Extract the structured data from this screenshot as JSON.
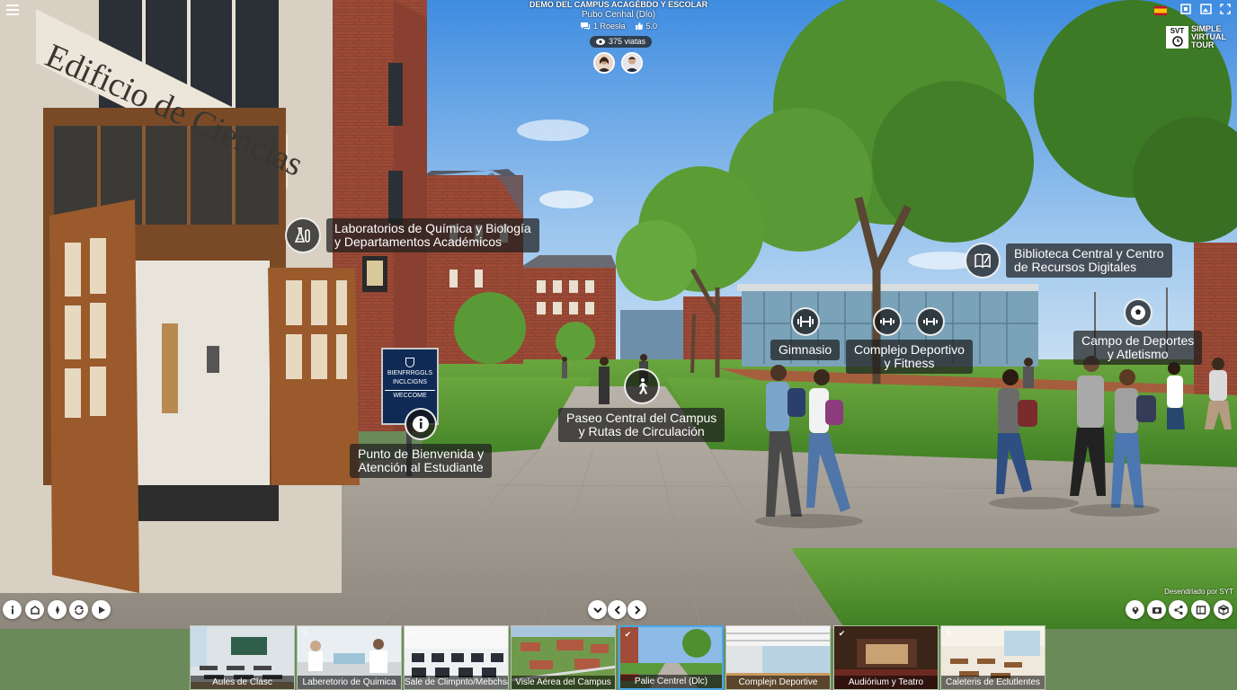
{
  "tour": {
    "title": "DEMO DEL CAMPUS ACAGÉBDO Y ESCOLAR",
    "subtitle": "Pubo Cenhal (Dlo)",
    "comments": "1 Roesła",
    "rating": "5.0",
    "views": "375 viatas"
  },
  "sign_text": "Edificio de Ciencias",
  "kiosk": {
    "line1": "BIENFRRGGLS",
    "line2": "INCLCIGNS",
    "line3": "WECCOME"
  },
  "hotspots": {
    "labs": "Laboratorios de Química y Biología y Departamentos Académicos",
    "labs_l1": "Laboratorios de Química y Biología",
    "labs_l2": "y Departamentos Académicos",
    "library_l1": "Biblioteca Central y Centro",
    "library_l2": "de Recursos Digitales",
    "gym": "Gimnasio",
    "sports_l1": "Complejo Deportivo",
    "sports_l2": "y Fitness",
    "field_l1": "Campo de Deportes",
    "field_l2": "y Atletismo",
    "walk_l1": "Paseo Central del Campus",
    "walk_l2": "y Rutas de Circulación",
    "welcome_l1": "Punto de Bienvenida y",
    "welcome_l2": "Atención al Estudiante"
  },
  "brand": {
    "line1": "SIMPLE",
    "line2": "VIRTUAL",
    "line3": "TOUR",
    "logo_text": "SVT"
  },
  "powered_by": "Desendrlado por SYT",
  "thumbnails": [
    {
      "label": "Aules de Clasc"
    },
    {
      "label": "Laberetorio de Quimica"
    },
    {
      "label": "Sale de Climpnto/Mebchsa"
    },
    {
      "label": "Visle Aérea del Campus"
    },
    {
      "label": "Palie Centrel (Dlc)"
    },
    {
      "label": "Complejn Deportive"
    },
    {
      "label": "Audiórium y Teatro"
    },
    {
      "label": "Caleteris de Eclutlentes"
    }
  ],
  "colors": {
    "accent": "#49a7e6",
    "brick": "#9a4a36",
    "grass": "#5b9a3a",
    "sky": "#6aa6e0"
  },
  "icons": [
    "menu-icon",
    "flag-icon",
    "vr-icon",
    "screenshot-icon",
    "fullscreen-icon",
    "info-icon",
    "rooms-icon",
    "compass-icon",
    "autorotate-icon",
    "play-icon",
    "chevron-down-icon",
    "arrow-left-icon",
    "arrow-right-icon",
    "location-icon",
    "camera-icon",
    "share-icon",
    "map-icon",
    "eye-icon"
  ]
}
